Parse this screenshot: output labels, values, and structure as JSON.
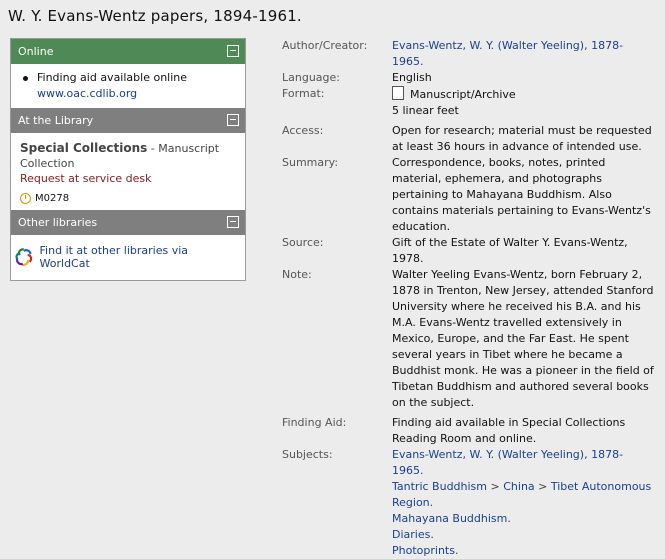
{
  "title": "W. Y. Evans-Wentz papers, 1894-1961.",
  "sidebar": {
    "online": {
      "header": "Online",
      "item_text": "Finding aid available online",
      "item_link": "www.oac.cdlib.org"
    },
    "library": {
      "header": "At the Library",
      "name": "Special Collections",
      "separator": " - ",
      "collection_a": "Manuscript",
      "collection_b": "Collection",
      "request": "Request at service desk",
      "call_number": "M0278"
    },
    "other": {
      "header": "Other libraries",
      "link": "Find it at other libraries via WorldCat"
    }
  },
  "details": {
    "author_label": "Author/Creator:",
    "author_value": "Evans-Wentz, W. Y. (Walter Yeeling), 1878-1965.",
    "language_label": "Language:",
    "language_value": "English",
    "format_label": "Format:",
    "format_value": "Manuscript/Archive",
    "format_extent": "5 linear feet",
    "access_label": "Access:",
    "access_value": "Open for research; material must be requested at least 36 hours in advance of intended use.",
    "summary_label": "Summary:",
    "summary_value": "Correspondence, books, notes, printed material, ephemera, and photographs pertaining to Mahayana Buddhism. Also contains materials pertaining to Evans-Wentz's education.",
    "source_label": "Source:",
    "source_value": "Gift of the Estate of Walter Y. Evans-Wentz, 1978.",
    "note_label": "Note:",
    "note_value": "Walter Yeeling Evans-Wentz, born February 2, 1878 in Trenton, New Jersey, attended Stanford University where he received his B.A. and his M.A. Evans-Wentz travelled extensively in Mexico, Europe, and the Far East. He spent several years in Tibet where he became a Buddhist monk. He was a pioneer in the field of Tibetan Buddhism and authored several books on the subject.",
    "finding_aid_label": "Finding Aid:",
    "finding_aid_value": "Finding aid available in Special Collections Reading Room and online.",
    "subjects_label": "Subjects:",
    "subjects": {
      "s1": "Evans-Wentz, W. Y. (Walter Yeeling), 1878-1965.",
      "s2a": "Tantric Buddhism",
      "s2b": "China",
      "s2c": "Tibet Autonomous Region.",
      "s3": "Mahayana Buddhism.",
      "s4": "Diaries.",
      "s5": "Photoprints."
    },
    "subject_sep": " > "
  },
  "colors": {
    "online_header": "#4d8a55",
    "grey_header": "#7f7f7f",
    "link": "#1a3f8a",
    "request": "#8b1a1a"
  },
  "icons": [
    "collapse-icon",
    "bullet-icon",
    "clock-icon",
    "worldcat-icon",
    "document-icon"
  ]
}
